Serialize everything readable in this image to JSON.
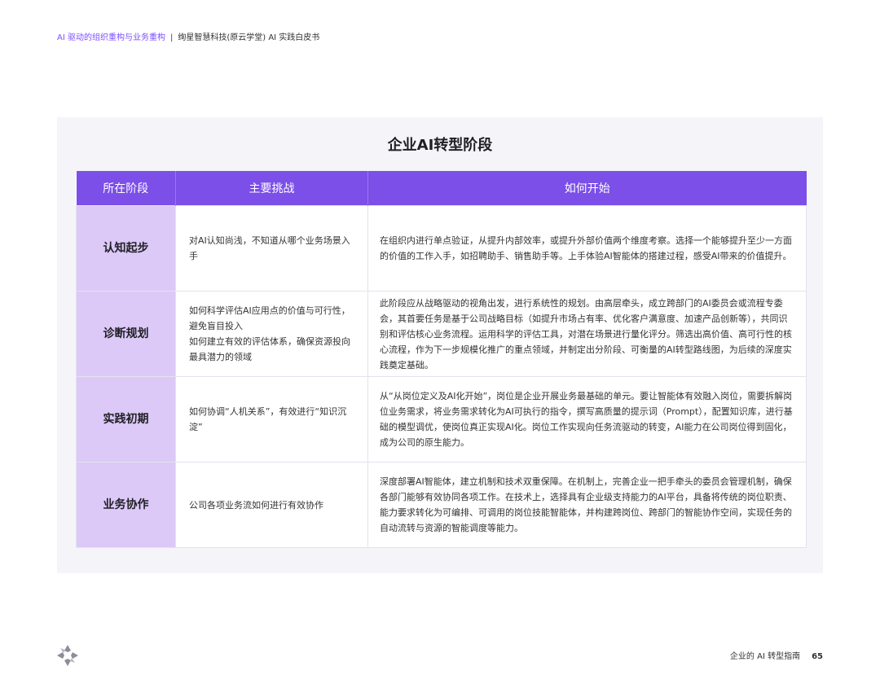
{
  "header": {
    "section": "AI 驱动的组织重构与业务重构",
    "separator": "|",
    "document": "绚星智慧科技(原云学堂) AI 实践白皮书"
  },
  "table": {
    "title": "企业AI转型阶段",
    "columns": [
      "所在阶段",
      "主要挑战",
      "如何开始"
    ],
    "rows": [
      {
        "stage": "认知起步",
        "challenge": [
          "对AI认知尚浅，不知道从哪个业务场景入手"
        ],
        "start": "在组织内进行单点验证，从提升内部效率，或提升外部价值两个维度考察。选择一个能够提升至少一方面的价值的工作入手，如招聘助手、销售助手等。上手体验AI智能体的搭建过程，感受AI带来的价值提升。"
      },
      {
        "stage": "诊断规划",
        "challenge": [
          "如何科学评估AI应用点的价值与可行性，避免盲目投入",
          "如何建立有效的评估体系，确保资源投向最具潜力的领域"
        ],
        "start": "此阶段应从战略驱动的视角出发，进行系统性的规划。由高层牵头，成立跨部门的AI委员会或流程专委会，其首要任务是基于公司战略目标（如提升市场占有率、优化客户满意度、加速产品创新等），共同识别和评估核心业务流程。运用科学的评估工具，对潜在场景进行量化评分。筛选出高价值、高可行性的核心流程，作为下一步规模化推广的重点领域，并制定出分阶段、可衡量的AI转型路线图，为后续的深度实践奠定基础。"
      },
      {
        "stage": "实践初期",
        "challenge": [
          "如何协调“人机关系”，有效进行“知识沉淀”"
        ],
        "start": "从“从岗位定义及AI化开始”，岗位是企业开展业务最基础的单元。要让智能体有效融入岗位，需要拆解岗位业务需求，将业务需求转化为AI可执行的指令，撰写高质量的提示词（Prompt），配置知识库，进行基础的模型调优，使岗位真正实现AI化。岗位工作实现向任务流驱动的转变，AI能力在公司岗位得到固化，成为公司的原生能力。"
      },
      {
        "stage": "业务协作",
        "challenge": [
          "公司各项业务流如何进行有效协作"
        ],
        "start": "深度部署AI智能体，建立机制和技术双重保障。在机制上，完善企业一把手牵头的委员会管理机制，确保各部门能够有效协同各项工作。在技术上，选择具有企业级支持能力的AI平台，具备将传统的岗位职责、能力要求转化为可编排、可调用的岗位技能智能体，并构建跨岗位、跨部门的智能协作空间，实现任务的自动流转与资源的智能调度等能力。"
      }
    ]
  },
  "footer": {
    "logo_icon": "brand-logo-icon",
    "guide_title": "企业的 AI 转型指南",
    "page_number": "65"
  },
  "colors": {
    "accent": "#7b4fe8",
    "stage_cell": "#dcc9f7",
    "panel_bg": "#f4f4f9",
    "section_text": "#7c4dff"
  }
}
